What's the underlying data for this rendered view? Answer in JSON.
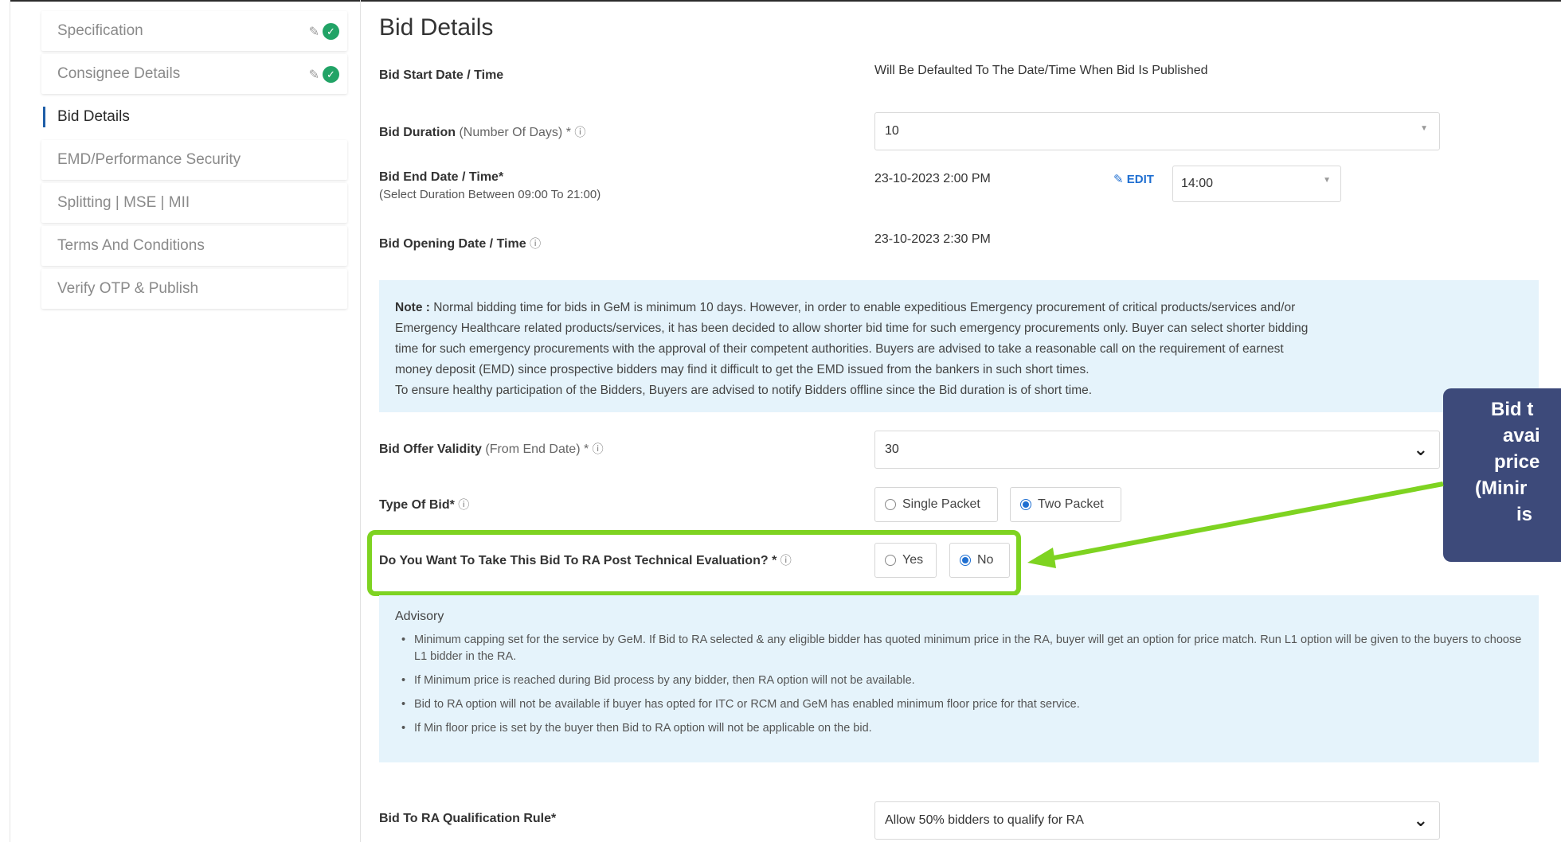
{
  "sidebar": {
    "items": [
      {
        "label": "Specification",
        "done": true
      },
      {
        "label": "Consignee Details",
        "done": true
      },
      {
        "label": "Bid Details",
        "active": true
      },
      {
        "label": "EMD/Performance Security"
      },
      {
        "label": "Splitting | MSE | MII"
      },
      {
        "label": "Terms And Conditions"
      },
      {
        "label": "Verify OTP & Publish"
      }
    ]
  },
  "main": {
    "title": "Bid Details",
    "bid_start": {
      "label": "Bid Start Date / Time",
      "value": "Will Be Defaulted To The Date/Time When Bid Is Published"
    },
    "bid_duration": {
      "label": "Bid Duration",
      "hint": "(Number Of Days) *",
      "value": "10"
    },
    "bid_end": {
      "label": "Bid End Date / Time*",
      "sub": "(Select Duration Between 09:00 To 21:00)",
      "value": "23-10-2023 2:00 PM",
      "edit": "EDIT",
      "time": "14:00"
    },
    "bid_opening": {
      "label": "Bid Opening Date / Time",
      "value": "23-10-2023 2:30 PM"
    },
    "note": {
      "prefix": "Note :",
      "lines": [
        "Normal bidding time for bids in GeM is minimum 10 days. However, in order to enable expeditious Emergency procurement of critical products/services and/or",
        "Emergency Healthcare related products/services, it has been decided to allow shorter bid time for such emergency procurements only. Buyer can select shorter bidding",
        "time for such emergency procurements with the approval of their competent authorities. Buyers are advised to take a reasonable call on the requirement of earnest",
        "money deposit (EMD) since prospective bidders may find it difficult to get the EMD issued from the bankers in such short times.",
        "To ensure healthy participation of the Bidders, Buyers are advised to notify Bidders offline since the Bid duration is of short time."
      ]
    },
    "offer_validity": {
      "label": "Bid Offer Validity",
      "hint": "(From End Date) *",
      "value": "30"
    },
    "type_of_bid": {
      "label": "Type Of Bid*",
      "opt1": "Single Packet",
      "opt2": "Two Packet",
      "selected": "Two Packet"
    },
    "ra": {
      "label": "Do You Want To Take This Bid To RA Post Technical Evaluation? *",
      "opt_yes": "Yes",
      "opt_no": "No",
      "selected": "No"
    },
    "advisory": {
      "title": "Advisory",
      "items": [
        "Minimum capping set for the service by GeM. If Bid to RA selected & any eligible bidder has quoted minimum price in the RA, buyer will get an option for price match. Run L1 option will be given to the buyers to choose L1 bidder in the RA.",
        "If Minimum price is reached during Bid process by any bidder, then RA option will not be available.",
        "Bid to RA option will not be available if buyer has opted for ITC or RCM and GeM has enabled minimum floor price for that service.",
        "If Min floor price is set by the buyer then Bid to RA option will not be applicable on the bid."
      ]
    },
    "qualification_rule": {
      "label": "Bid To RA Qualification Rule*",
      "value": "Allow 50% bidders to qualify for RA"
    }
  },
  "callout": {
    "lines": [
      "Bid t",
      "avai",
      "price",
      "(Minir",
      "is"
    ]
  },
  "colors": {
    "accent": "#1f6fd1",
    "highlight": "#7ed321",
    "callout_bg": "#3d4a7a",
    "note_bg": "#e5f3fb",
    "check": "#21a366"
  }
}
